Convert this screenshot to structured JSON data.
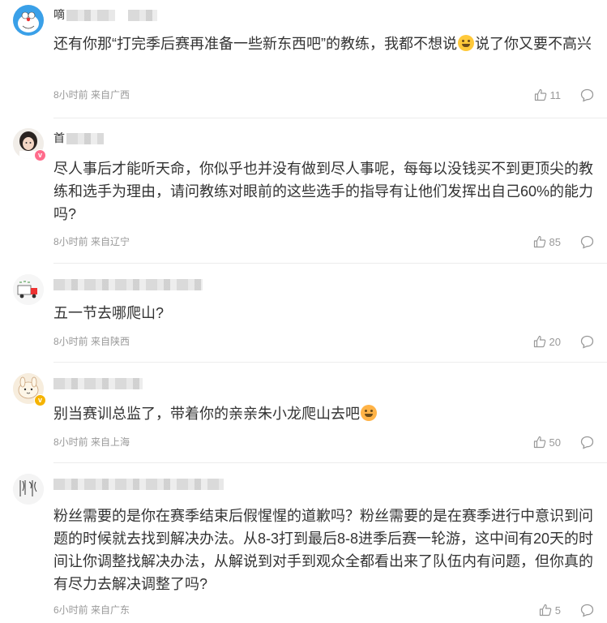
{
  "comments": [
    {
      "username_visible": "嘀",
      "content_before": "还有你那“打完季后赛再准备一些新东西吧”的教练，我都不想说",
      "content_after": "说了你又要不高兴",
      "emoji": "grinning-sweat-emoji",
      "time": "8小时前",
      "location": "来自广西",
      "likes": "11"
    },
    {
      "username_visible": "首",
      "content": "尽人事后才能听天命，你似乎也并没有做到尽人事呢，每每以没钱买不到更顶尖的教练和选手为理由，请问教练对眼前的这些选手的指导有让他们发挥出自己60%的能力吗?",
      "time": "8小时前",
      "location": "来自辽宁",
      "likes": "85"
    },
    {
      "username_visible": "",
      "content": "五一节去哪爬山?",
      "time": "8小时前",
      "location": "来自陕西",
      "likes": "20"
    },
    {
      "username_visible": "",
      "content_before": "别当赛训总监了，带着你的亲亲朱小龙爬山去吧",
      "content_after": "",
      "emoji": "hot-face-emoji",
      "time": "8小时前",
      "location": "来自上海",
      "likes": "50"
    },
    {
      "username_visible": "",
      "content": "粉丝需要的是你在赛季结束后假惺惺的道歉吗？粉丝需要的是在赛季进行中意识到问题的时候就去找到解决办法。从8-3打到最后8-8进季后赛一轮游，这中间有20天的时间让你调整找解决办法，从解说到对手到观众全都看出来了队伍内有问题，但你真的有尽力去解决调整了吗?",
      "time": "6小时前",
      "location": "来自广东",
      "likes": "5"
    }
  ],
  "colors": {
    "text": "#333333",
    "meta": "#999999",
    "badge_pink": "#ff6b8b",
    "badge_gold": "#f5b300"
  }
}
